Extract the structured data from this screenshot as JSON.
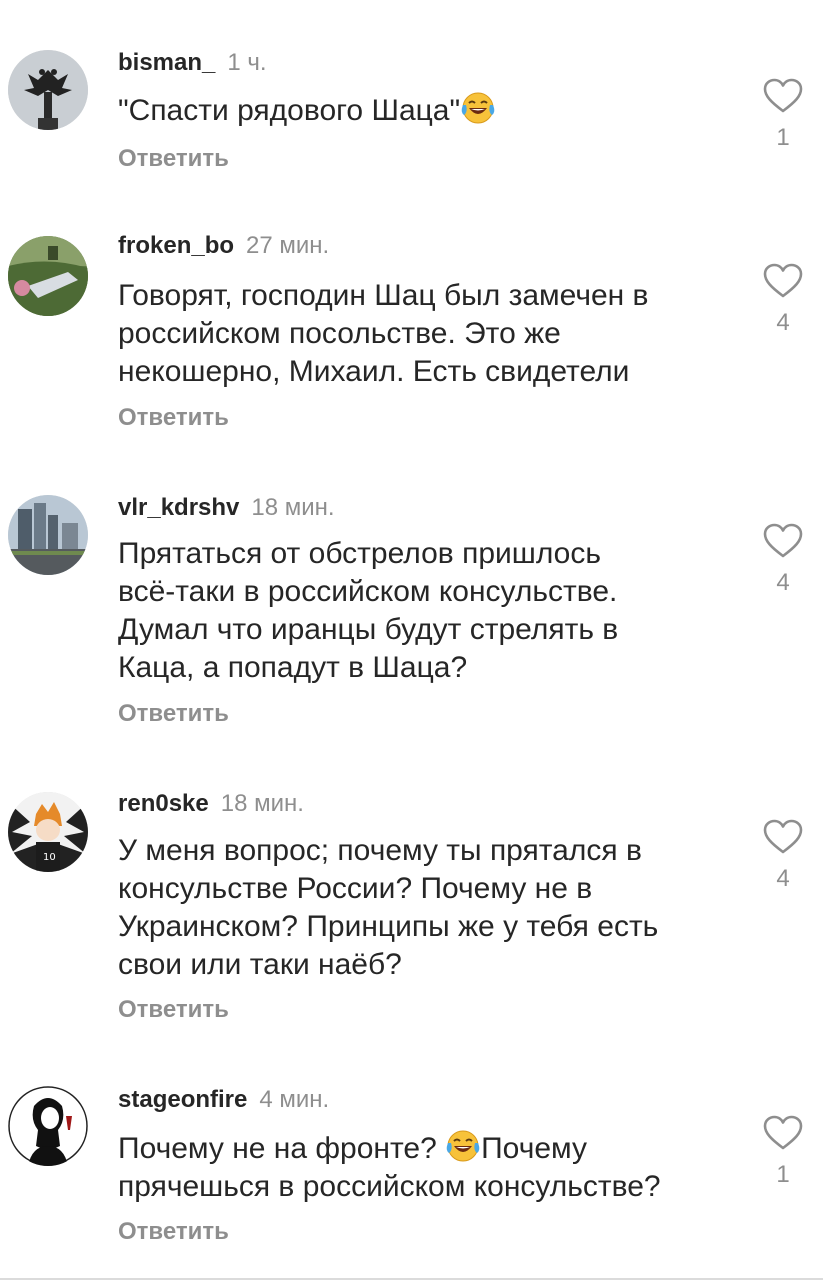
{
  "reply_label": "Ответить",
  "comments": [
    {
      "username": "bisman_",
      "time": "1 ч.",
      "text_before": "\"Спасти рядового Шаца\"",
      "emoji": "face-with-tears-of-joy",
      "text_after": "",
      "likes": "1",
      "avatar": "eagle-emblem-icon"
    },
    {
      "username": "froken_bo",
      "time": "27 мин.",
      "text_lines": [
        "Говорят, господин Шац был замечен в",
        "российском посольстве. Это же",
        "некошерно, Михаил. Есть свидетели"
      ],
      "likes": "4",
      "avatar": "park-photo-avatar"
    },
    {
      "username": "vlr_kdrshv",
      "time": "18 мин.",
      "text_lines": [
        "Прятаться от обстрелов пришлось",
        "всё-таки в российском консульстве.",
        "Думал что иранцы будут стрелять в",
        "Каца, а попадут в Шаца?"
      ],
      "likes": "4",
      "avatar": "city-street-avatar"
    },
    {
      "username": "ren0ske",
      "time": "18 мин.",
      "text_lines": [
        "У меня вопрос; почему ты прятался в",
        "консульстве России? Почему не в",
        "Украинском? Принципы же у тебя есть",
        "свои или таки наёб?"
      ],
      "likes": "4",
      "avatar": "anime-player-avatar"
    },
    {
      "username": "stageonfire",
      "time": "4 мин.",
      "line1_before": "Почему не на фронте? ",
      "emoji": "face-with-tears-of-joy",
      "line1_after": "Почему",
      "line2": "прячешься в российском консульстве?",
      "likes": "1",
      "avatar": "woman-sketch-avatar"
    }
  ],
  "colors": {
    "primary_text": "#262626",
    "secondary_text": "#8e8e8e",
    "heart_stroke": "#8e8e8e",
    "background": "#ffffff"
  }
}
